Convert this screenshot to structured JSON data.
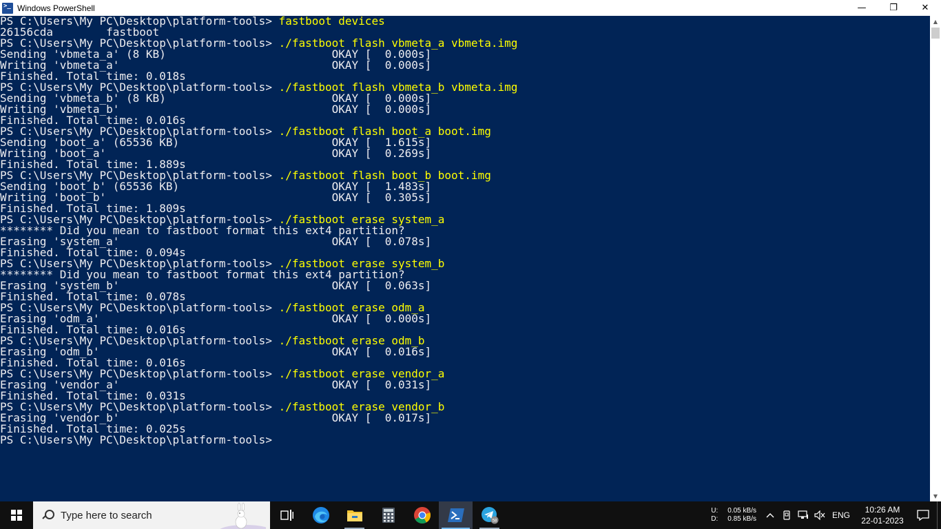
{
  "window": {
    "title": "Windows PowerShell",
    "minimize_glyph": "—",
    "maximize_glyph": "❐",
    "close_glyph": "✕"
  },
  "console": {
    "lines": [
      {
        "text": "PS C:\\Users\\My PC\\Desktop\\platform-tools> ",
        "cmd": "fastboot devices"
      },
      {
        "text": "26156cda        fastboot"
      },
      {
        "text": "PS C:\\Users\\My PC\\Desktop\\platform-tools> ",
        "cmd": "./fastboot flash vbmeta_a vbmeta.img"
      },
      {
        "text": "Sending 'vbmeta_a' (8 KB)                         OKAY [  0.000s]"
      },
      {
        "text": "Writing 'vbmeta_a'                                OKAY [  0.000s]"
      },
      {
        "text": "Finished. Total time: 0.018s"
      },
      {
        "text": "PS C:\\Users\\My PC\\Desktop\\platform-tools> ",
        "cmd": "./fastboot flash vbmeta_b vbmeta.img"
      },
      {
        "text": "Sending 'vbmeta_b' (8 KB)                         OKAY [  0.000s]"
      },
      {
        "text": "Writing 'vbmeta_b'                                OKAY [  0.000s]"
      },
      {
        "text": "Finished. Total time: 0.016s"
      },
      {
        "text": "PS C:\\Users\\My PC\\Desktop\\platform-tools> ",
        "cmd": "./fastboot flash boot_a boot.img"
      },
      {
        "text": "Sending 'boot_a' (65536 KB)                       OKAY [  1.615s]"
      },
      {
        "text": "Writing 'boot_a'                                  OKAY [  0.269s]"
      },
      {
        "text": "Finished. Total time: 1.889s"
      },
      {
        "text": "PS C:\\Users\\My PC\\Desktop\\platform-tools> ",
        "cmd": "./fastboot flash boot_b boot.img"
      },
      {
        "text": "Sending 'boot_b' (65536 KB)                       OKAY [  1.483s]"
      },
      {
        "text": "Writing 'boot_b'                                  OKAY [  0.305s]"
      },
      {
        "text": "Finished. Total time: 1.809s"
      },
      {
        "text": "PS C:\\Users\\My PC\\Desktop\\platform-tools> ",
        "cmd": "./fastboot erase system_a"
      },
      {
        "text": "******** Did you mean to fastboot format this ext4 partition?"
      },
      {
        "text": "Erasing 'system_a'                                OKAY [  0.078s]"
      },
      {
        "text": "Finished. Total time: 0.094s"
      },
      {
        "text": "PS C:\\Users\\My PC\\Desktop\\platform-tools> ",
        "cmd": "./fastboot erase system_b"
      },
      {
        "text": "******** Did you mean to fastboot format this ext4 partition?"
      },
      {
        "text": "Erasing 'system_b'                                OKAY [  0.063s]"
      },
      {
        "text": "Finished. Total time: 0.078s"
      },
      {
        "text": "PS C:\\Users\\My PC\\Desktop\\platform-tools> ",
        "cmd": "./fastboot erase odm_a"
      },
      {
        "text": "Erasing 'odm_a'                                   OKAY [  0.000s]"
      },
      {
        "text": "Finished. Total time: 0.016s"
      },
      {
        "text": "PS C:\\Users\\My PC\\Desktop\\platform-tools> ",
        "cmd": "./fastboot erase odm_b"
      },
      {
        "text": "Erasing 'odm_b'                                   OKAY [  0.016s]"
      },
      {
        "text": "Finished. Total time: 0.016s"
      },
      {
        "text": "PS C:\\Users\\My PC\\Desktop\\platform-tools> ",
        "cmd": "./fastboot erase vendor_a"
      },
      {
        "text": "Erasing 'vendor_a'                                OKAY [  0.031s]"
      },
      {
        "text": "Finished. Total time: 0.031s"
      },
      {
        "text": "PS C:\\Users\\My PC\\Desktop\\platform-tools> ",
        "cmd": "./fastboot erase vendor_b"
      },
      {
        "text": "Erasing 'vendor_b'                                OKAY [  0.017s]"
      },
      {
        "text": "Finished. Total time: 0.025s"
      },
      {
        "text": "PS C:\\Users\\My PC\\Desktop\\platform-tools> "
      }
    ]
  },
  "colors": {
    "console_bg": "#012456",
    "console_fg": "#eeedf0",
    "command_fg": "#ffff00",
    "taskbar_bg": "#101010",
    "active_accent": "#76b9ed"
  },
  "taskbar": {
    "search_placeholder": "Type here to search",
    "icons": [
      "task-view-icon",
      "edge-icon",
      "file-explorer-icon",
      "calculator-icon",
      "chrome-icon",
      "powershell-icon",
      "telegram-icon"
    ],
    "telegram_badge": "58"
  },
  "tray": {
    "net_upload_label": "U:",
    "net_download_label": "D:",
    "net_upload_speed": "0.05 kB/s",
    "net_download_speed": "0.85 kB/s",
    "language": "ENG",
    "time": "10:26 AM",
    "date": "22-01-2023"
  }
}
